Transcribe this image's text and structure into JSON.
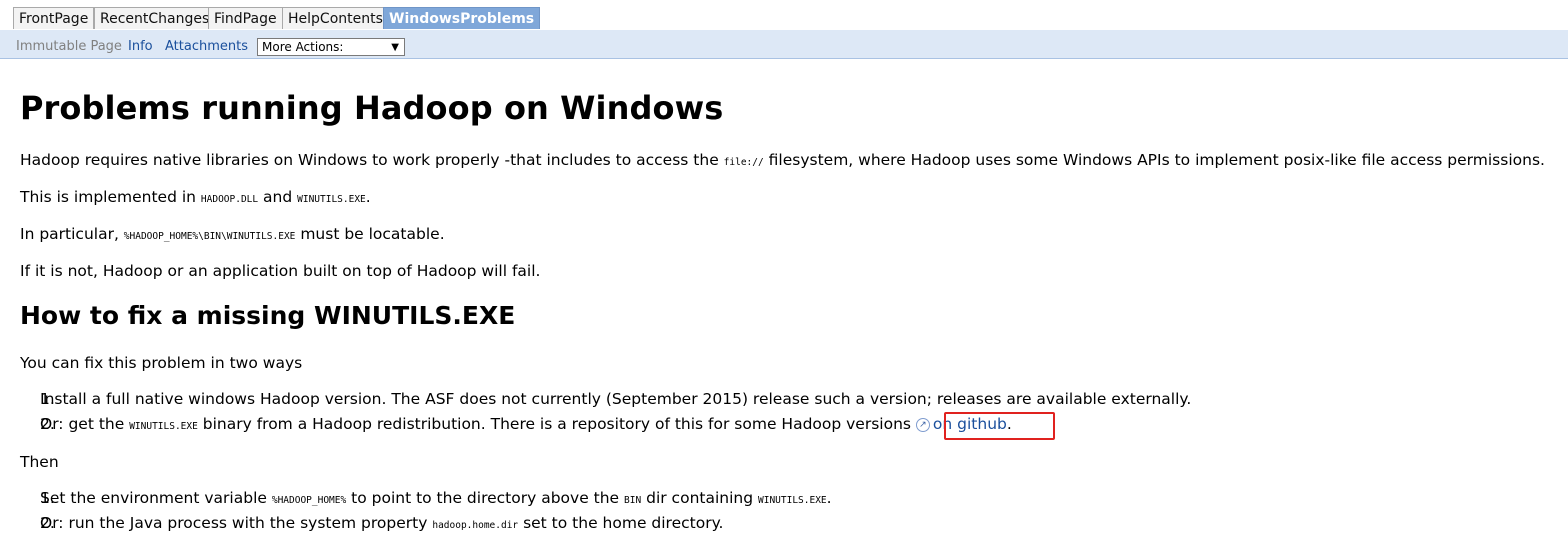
{
  "nav": {
    "tabs": [
      {
        "label": "FrontPage"
      },
      {
        "label": "RecentChanges"
      },
      {
        "label": "FindPage"
      },
      {
        "label": "HelpContents"
      },
      {
        "label": "WindowsProblems",
        "active": true
      }
    ]
  },
  "actions": {
    "immutable": "Immutable Page",
    "info": "Info",
    "attachments": "Attachments",
    "more_actions": "More Actions:"
  },
  "page": {
    "title": "Problems running Hadoop on Windows",
    "p1": {
      "before": "Hadoop requires native libraries on Windows to work properly -that includes to access the ",
      "code": "file://",
      "after": " filesystem, where Hadoop uses some Windows APIs to implement posix-like file access permissions."
    },
    "p2": {
      "before": "This is implemented in ",
      "code1": "HADOOP.DLL",
      "mid": " and ",
      "code2": "WINUTILS.EXE",
      "after": "."
    },
    "p3": {
      "before": "In particular, ",
      "code": "%HADOOP_HOME%\\BIN\\WINUTILS.EXE",
      "after": " must be locatable."
    },
    "p4": "If it is not, Hadoop or an application built on top of Hadoop will fail.",
    "h2": "How to fix a missing WINUTILS.EXE",
    "p5": "You can fix this problem in two ways",
    "list1": {
      "item1": {
        "num": "1.",
        "text": "Install a full native windows Hadoop version. The ASF does not currently (September 2015) release such a version; releases are available externally."
      },
      "item2": {
        "num": "2.",
        "before": "Or: get the ",
        "code": "WINUTILS.EXE",
        "mid": " binary from a Hadoop redistribution. There is a repository of this for some Hadoop versions ",
        "link": "on github",
        "after": "."
      }
    },
    "then": "Then",
    "list2": {
      "item1": {
        "num": "1.",
        "before": "Set the environment variable ",
        "code1": "%HADOOP_HOME%",
        "mid": " to point to the directory above the ",
        "code2": "BIN",
        "mid2": " dir containing ",
        "code3": "WINUTILS.EXE",
        "after": "."
      },
      "item2": {
        "num": "2.",
        "before": "Or: run the Java process with the system property ",
        "code": "hadoop.home.dir",
        "after": " set to the home directory."
      }
    }
  },
  "colors": {
    "link": "#1a4f9c",
    "active_tab": "#7fa7d9",
    "actionbar": "#dde8f6",
    "highlight_box": "#e0221f"
  }
}
